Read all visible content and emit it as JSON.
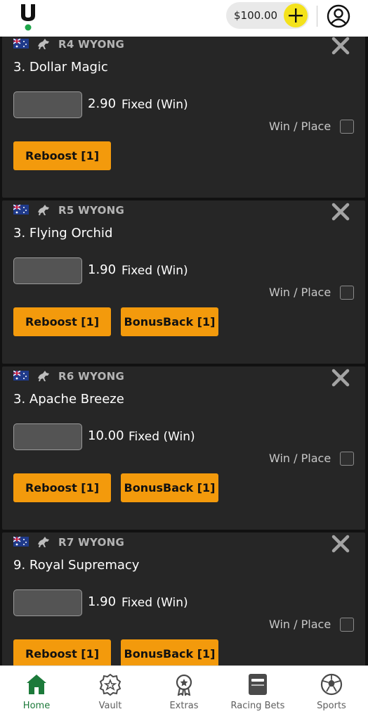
{
  "header": {
    "balance": "$100.00"
  },
  "bets": [
    {
      "race": "R4 WYONG",
      "runner": "3. Dollar Magic",
      "odds": "2.90",
      "bet_type": "Fixed (Win)",
      "win_place_label": "Win / Place",
      "reboost_label": "Reboost [1]",
      "bonus_label": ""
    },
    {
      "race": "R5 WYONG",
      "runner": "3. Flying Orchid",
      "odds": "1.90",
      "bet_type": "Fixed (Win)",
      "win_place_label": "Win / Place",
      "reboost_label": "Reboost [1]",
      "bonus_label": "BonusBack [1]"
    },
    {
      "race": "R6 WYONG",
      "runner": "3. Apache Breeze",
      "odds": "10.00",
      "bet_type": "Fixed (Win)",
      "win_place_label": "Win / Place",
      "reboost_label": "Reboost [1]",
      "bonus_label": "BonusBack [1]"
    },
    {
      "race": "R7 WYONG",
      "runner": "9. Royal Supremacy",
      "odds": "1.90",
      "bet_type": "Fixed (Win)",
      "win_place_label": "Win / Place",
      "reboost_label": "Reboost [1]",
      "bonus_label": "BonusBack [1]"
    }
  ],
  "nav": {
    "home": "Home",
    "vault": "Vault",
    "extras": "Extras",
    "racing_bets": "Racing Bets",
    "sports": "Sports"
  },
  "colors": {
    "accent": "#f39a0c",
    "brand_green": "#1c7a3a",
    "add_yellow": "#f4e21b",
    "card_bg": "#262626"
  }
}
